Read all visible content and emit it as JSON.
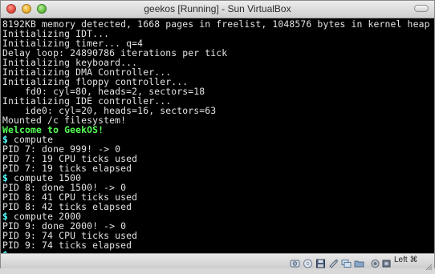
{
  "window": {
    "title": "geekos [Running] - Sun VirtualBox"
  },
  "console": {
    "lines": [
      {
        "text": "8192KB memory detected, 1668 pages in freelist, 1048576 bytes in kernel heap",
        "color": "white"
      },
      {
        "text": "Initializing IDT...",
        "color": "white"
      },
      {
        "text": "Initializing timer... q=4",
        "color": "white"
      },
      {
        "text": "Delay loop: 24890786 iterations per tick",
        "color": "white"
      },
      {
        "text": "Initializing keyboard...",
        "color": "white"
      },
      {
        "text": "Initializing DMA Controller...",
        "color": "white"
      },
      {
        "text": "Initializing floppy controller...",
        "color": "white"
      },
      {
        "text": "    fd0: cyl=80, heads=2, sectors=18",
        "color": "white"
      },
      {
        "text": "Initializing IDE controller...",
        "color": "white"
      },
      {
        "text": "    ide0: cyl=20, heads=16, sectors=63",
        "color": "white"
      },
      {
        "text": "Mounted /c filesystem!",
        "color": "white"
      },
      {
        "text": "Welcome to GeekOS!",
        "color": "green"
      },
      {
        "prompt": "$",
        "text": " compute",
        "color": "white"
      },
      {
        "text": "PID 7: done 999! -> 0",
        "color": "white"
      },
      {
        "text": "PID 7: 19 CPU ticks used",
        "color": "white"
      },
      {
        "text": "PID 7: 19 ticks elapsed",
        "color": "white"
      },
      {
        "prompt": "$",
        "text": " compute 1500",
        "color": "white"
      },
      {
        "text": "PID 8: done 1500! -> 0",
        "color": "white"
      },
      {
        "text": "PID 8: 41 CPU ticks used",
        "color": "white"
      },
      {
        "text": "PID 8: 42 ticks elapsed",
        "color": "white"
      },
      {
        "prompt": "$",
        "text": " compute 2000",
        "color": "white"
      },
      {
        "text": "PID 9: done 2000! -> 0",
        "color": "white"
      },
      {
        "text": "PID 9: 74 CPU ticks used",
        "color": "white"
      },
      {
        "text": "PID 9: 74 ticks elapsed",
        "color": "white"
      },
      {
        "prompt": "$",
        "text": "",
        "cursor": true,
        "color": "white"
      }
    ],
    "colors": {
      "white": "#e3e3e3",
      "green": "#55ff55",
      "cyan": "#55ffff",
      "background": "#000000"
    }
  },
  "statusbar": {
    "icons": [
      "hard-disk-icon",
      "optical-drive-icon",
      "floppy-drive-icon",
      "usb-icon",
      "network-icon",
      "shared-folders-icon",
      "recording-icon",
      "mouse-integration-icon",
      "hardware-virtualization-icon"
    ],
    "host_key_label": "Left ⌘"
  }
}
